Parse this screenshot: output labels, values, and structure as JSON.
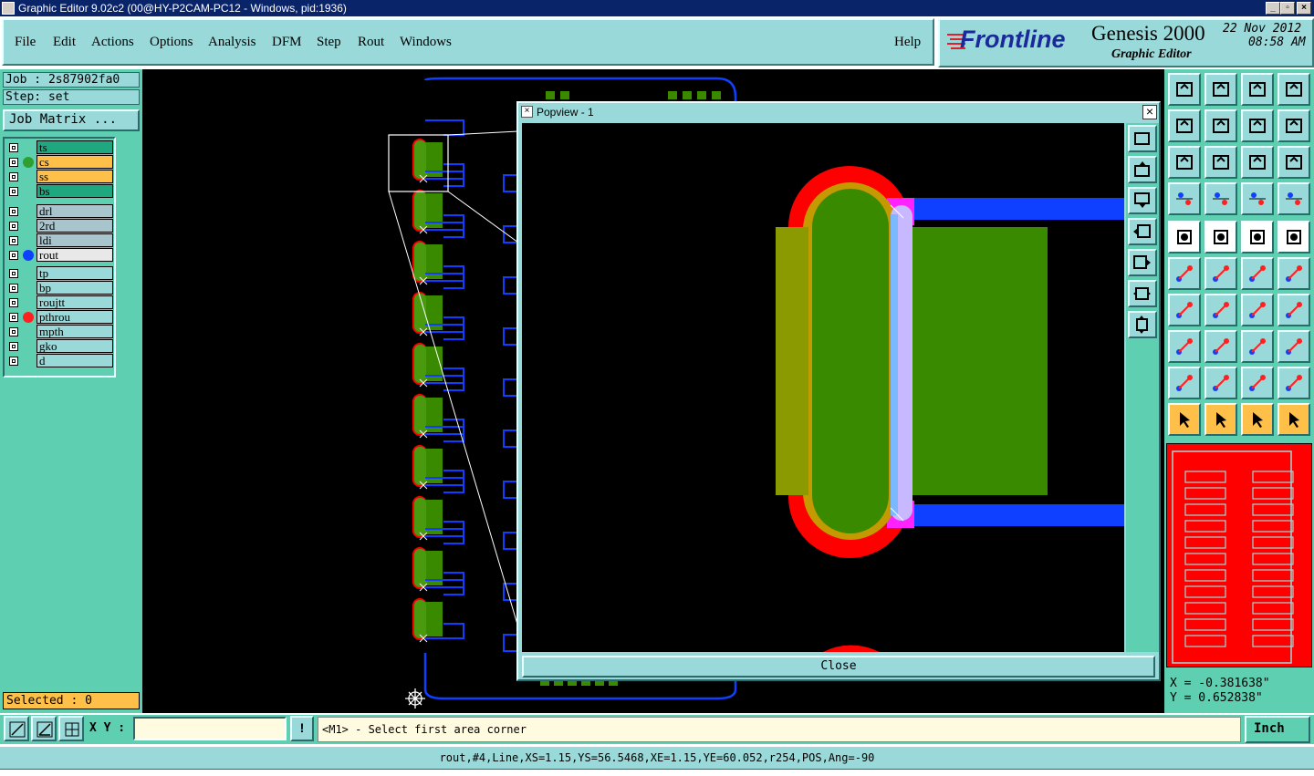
{
  "window": {
    "title": "Graphic Editor 9.02c2 (00@HY-P2CAM-PC12 - Windows, pid:1936)"
  },
  "menu": {
    "items": [
      "File",
      "Edit",
      "Actions",
      "Options",
      "Analysis",
      "DFM",
      "Step",
      "Rout",
      "Windows"
    ],
    "help": "Help"
  },
  "brand": {
    "logo": "Frontline",
    "product": "Genesis 2000",
    "subtitle": "Graphic Editor",
    "date": "22 Nov 2012",
    "time": "08:58 AM"
  },
  "job": {
    "job_label": "Job : 2s87902fa0",
    "step_label": "Step: set",
    "matrix_button": "Job Matrix ..."
  },
  "layers": {
    "group1": [
      {
        "name": "ts",
        "bg": "#1fa880",
        "dot": ""
      },
      {
        "name": "cs",
        "bg": "#ffc04a",
        "dot": "#2fa02f"
      },
      {
        "name": "ss",
        "bg": "#ffc04a",
        "dot": ""
      },
      {
        "name": "bs",
        "bg": "#1fa880",
        "dot": ""
      }
    ],
    "group2": [
      {
        "name": "drl",
        "bg": "#a8c4cc",
        "dot": ""
      },
      {
        "name": "2rd",
        "bg": "#a8c4cc",
        "dot": ""
      },
      {
        "name": "ldi",
        "bg": "#a8c4cc",
        "dot": ""
      },
      {
        "name": "rout",
        "bg": "#e8e8e8",
        "dot": "#1040ff"
      }
    ],
    "group3": [
      {
        "name": "tp",
        "bg": "#9ad9d9",
        "dot": ""
      },
      {
        "name": "bp",
        "bg": "#9ad9d9",
        "dot": ""
      },
      {
        "name": "roujtt",
        "bg": "#9ad9d9",
        "dot": ""
      },
      {
        "name": "pthrou",
        "bg": "#9ad9d9",
        "dot": "#ff2020"
      },
      {
        "name": "mpth",
        "bg": "#9ad9d9",
        "dot": ""
      },
      {
        "name": "gko",
        "bg": "#9ad9d9",
        "dot": ""
      },
      {
        "name": "d",
        "bg": "#9ad9d9",
        "dot": ""
      }
    ]
  },
  "selected": "Selected : 0",
  "popview": {
    "title": "Popview - 1",
    "close_label": "Close"
  },
  "coords": {
    "x": "X = -0.381638\"",
    "y": "Y =  0.652838\""
  },
  "command": {
    "xy_label": "X Y :",
    "xy_value": "",
    "prompt": "<M1> - Select first area corner",
    "units": "Inch"
  },
  "status": {
    "text": "rout,#4,Line,XS=1.15,YS=56.5468,XE=1.15,YE=60.052,r254,POS,Ang=-90"
  },
  "colors": {
    "teal_panel": "#5ecfb0",
    "light_panel": "#9ad9d9",
    "copper_green": "#3a8a00",
    "rout_blue": "#1040ff",
    "pth_red": "#ff0000"
  }
}
